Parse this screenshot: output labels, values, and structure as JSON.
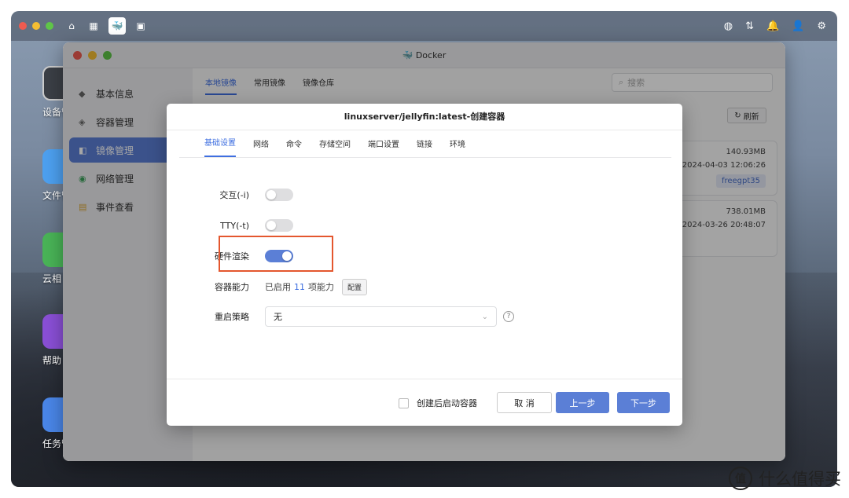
{
  "desktop": {
    "icons": [
      {
        "label": "设备管",
        "color": "#3b3f46"
      },
      {
        "label": "文件管",
        "color": "#4da0f0"
      },
      {
        "label": "云相",
        "color": "#49b457"
      },
      {
        "label": "帮助",
        "color": "#8a4fd6"
      },
      {
        "label": "任务管",
        "color": "#4a86e8"
      }
    ]
  },
  "window": {
    "title": "Docker",
    "sidebar": [
      {
        "label": "基本信息",
        "icon": "pin-icon"
      },
      {
        "label": "容器管理",
        "icon": "container-icon"
      },
      {
        "label": "镜像管理",
        "icon": "image-icon"
      },
      {
        "label": "网络管理",
        "icon": "network-icon"
      },
      {
        "label": "事件查看",
        "icon": "event-icon"
      }
    ],
    "tabs": [
      "本地镜像",
      "常用镜像",
      "镜像仓库"
    ],
    "search_placeholder": "搜索",
    "refresh_label": "刷新",
    "images": [
      {
        "size": "140.93MB",
        "date": "2024-04-03 12:06:26",
        "tag": "freegpt35"
      },
      {
        "size": "738.01MB",
        "date": "2024-03-26 20:48:07"
      }
    ]
  },
  "dialog": {
    "title": "linuxserver/jellyfin:latest-创建容器",
    "tabs": [
      "基础设置",
      "网络",
      "命令",
      "存储空间",
      "端口设置",
      "链接",
      "环境"
    ],
    "fields": {
      "interactive_label": "交互(-i)",
      "interactive_on": false,
      "tty_label": "TTY(-t)",
      "tty_on": false,
      "hw_label": "硬件渲染",
      "hw_on": true,
      "cap_label": "容器能力",
      "cap_prefix": "已启用",
      "cap_count": "11",
      "cap_suffix": "项能力",
      "cap_button": "配置",
      "restart_label": "重启策略",
      "restart_value": "无"
    },
    "footer": {
      "autostart_label": "创建后启动容器",
      "cancel_label": "取 消",
      "prev_label": "上一步",
      "next_label": "下一步"
    }
  },
  "watermark": {
    "logo": "值",
    "text": "什么值得买"
  },
  "colors": {
    "accent": "#5b7fd6",
    "highlight": "#e4572e"
  }
}
